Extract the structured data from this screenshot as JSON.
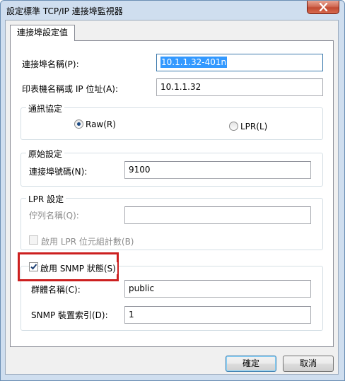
{
  "window": {
    "title": "設定標準 TCP/IP 連接埠監視器"
  },
  "tabs": [
    {
      "label": "連接埠設定值"
    }
  ],
  "port_name": {
    "label": "連接埠名稱(P):",
    "value": "10.1.1.32-401n"
  },
  "printer_name": {
    "label": "印表機名稱或 IP 位址(A):",
    "value": "10.1.1.32"
  },
  "protocol": {
    "legend": "通訊協定",
    "raw_label": "Raw(R)",
    "lpr_label": "LPR(L)",
    "selected": "Raw(R)"
  },
  "raw_settings": {
    "legend": "原始設定",
    "port_number_label": "連接埠號碼(N):",
    "port_number_value": "9100"
  },
  "lpr_settings": {
    "legend": "LPR 設定",
    "queue_name_label": "佇列名稱(Q):",
    "queue_name_value": "",
    "byte_count_label": "啟用 LPR 位元組計數(B)",
    "byte_count_checked": false
  },
  "snmp": {
    "enable_label": "啟用 SNMP 狀態(S)",
    "enabled": true,
    "community_label": "群體名稱(C):",
    "community_value": "public",
    "device_index_label": "SNMP 裝置索引(D):",
    "device_index_value": "1"
  },
  "buttons": {
    "ok_label": "確定",
    "cancel_label": "取消"
  },
  "colors": {
    "highlight_box": "#cc1f1f",
    "selection": "#3399ff",
    "title_close": "#c14b33"
  }
}
